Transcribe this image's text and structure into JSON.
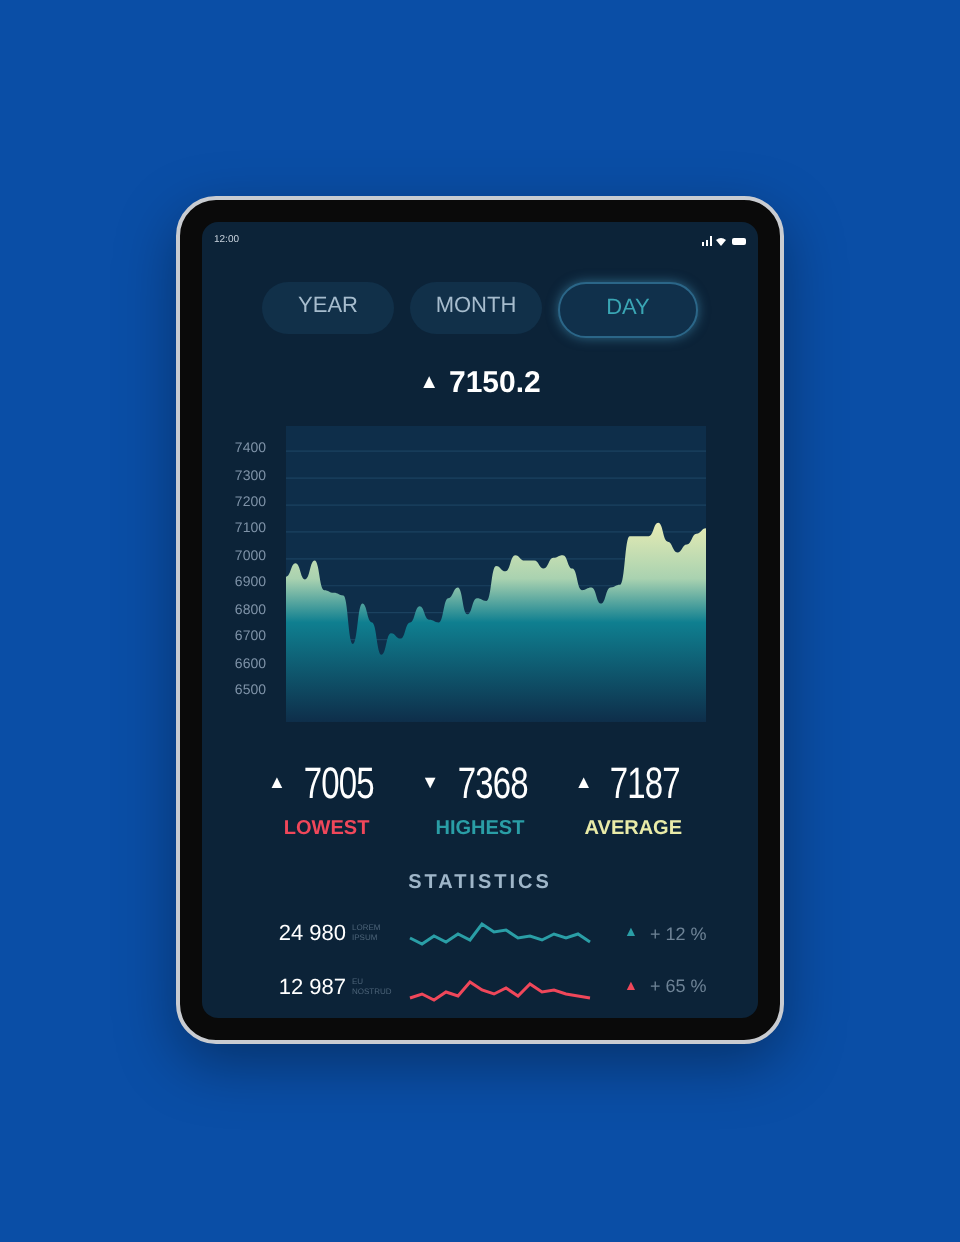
{
  "status_bar": {
    "time": "12:00"
  },
  "tabs": [
    {
      "label": "YEAR",
      "selected": false
    },
    {
      "label": "MONTH",
      "selected": false
    },
    {
      "label": "DAY",
      "selected": true
    }
  ],
  "current": {
    "arrow": "▲",
    "value": "7150.2"
  },
  "chart_data": {
    "type": "area",
    "ylim": [
      6390,
      7490
    ],
    "yticks": [
      6500,
      6600,
      6700,
      6800,
      6900,
      7000,
      7100,
      7200,
      7300,
      7400
    ],
    "grid": true,
    "series": [
      {
        "color": "#e6ebb4",
        "values": [
          6930,
          6980,
          6920,
          6990,
          6880,
          6870,
          6860,
          6680,
          6830,
          6760,
          6640,
          6720,
          6700,
          6760,
          6820,
          6770,
          6760,
          6850,
          6890,
          6790,
          6850,
          6840,
          6970,
          6950,
          7010,
          6990,
          6990,
          6960,
          7000,
          7010,
          6960,
          6880,
          6890,
          6830,
          6890,
          6900,
          7080,
          7080,
          7080,
          7130,
          7060,
          7020,
          7050,
          7090,
          7110
        ]
      }
    ]
  },
  "summary": [
    {
      "arrow": "▲",
      "value": "7005",
      "label": "LOWEST",
      "color": "#f0475a"
    },
    {
      "arrow": "▼",
      "value": "7368",
      "label": "HIGHEST",
      "color": "#2a9ea6"
    },
    {
      "arrow": "▲",
      "value": "7187",
      "label": "AVERAGE",
      "color": "#e9eba8"
    }
  ],
  "statistics": {
    "title": "STATISTICS",
    "rows": [
      {
        "value": "24 980",
        "caption": "LOREM IPSUM",
        "color": "#2a9ea6",
        "arrow": "▲",
        "change": "+ 12 %"
      },
      {
        "value": "12 987",
        "caption": "EU NOSTRUD",
        "color": "#f0475a",
        "arrow": "▲",
        "change": "+ 65 %"
      }
    ]
  }
}
